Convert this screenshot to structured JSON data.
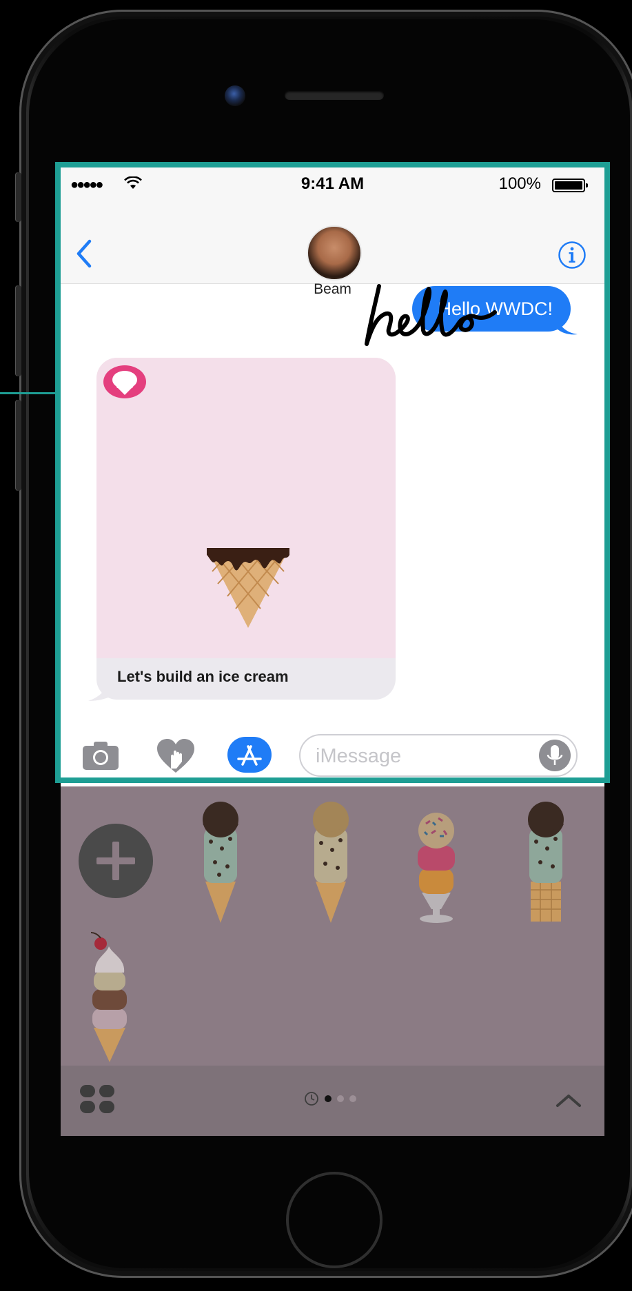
{
  "status_bar": {
    "signal": "●●●●●",
    "time": "9:41 AM",
    "battery": "100%"
  },
  "nav": {
    "contact_name": "Beam",
    "back_icon": "chevron-left-icon",
    "info_icon": "info-icon"
  },
  "messages": {
    "sent": {
      "text": "Hello WWDC!",
      "handwriting": "hello",
      "color": "#1f7cf6"
    },
    "received_card": {
      "caption": "Let's build an ice cream",
      "background": "#f4dfea"
    }
  },
  "input_bar": {
    "placeholder": "iMessage",
    "camera_icon": "camera-icon",
    "digital_touch_icon": "heart-hand-icon",
    "app_store_icon": "app-store-icon",
    "mic_icon": "microphone-icon"
  },
  "drawer": {
    "add_icon": "plus-icon",
    "stickers": [
      "mint-chip-chocolate-cone",
      "vanilla-chip-cone",
      "sprinkle-sundae",
      "mint-chip-waffle-cone",
      "cherry-triple-scoop-cone"
    ],
    "page_count": 3,
    "current_page": 1,
    "grid_icon": "app-grid-icon",
    "expand_icon": "chevron-up-icon"
  },
  "colors": {
    "accent": "#1f7cf6",
    "highlight": "#1e9e94",
    "badge": "#e43f7e"
  }
}
